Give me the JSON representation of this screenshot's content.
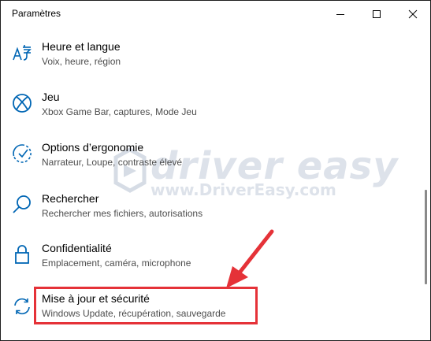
{
  "window": {
    "title": "Paramètres",
    "controls": {
      "minimize": "minimize-icon",
      "maximize": "maximize-icon",
      "close": "close-icon"
    }
  },
  "settings_items": [
    {
      "icon": "language-icon",
      "label": "Heure et langue",
      "description": "Voix, heure, région"
    },
    {
      "icon": "xbox-icon",
      "label": "Jeu",
      "description": "Xbox Game Bar, captures, Mode Jeu"
    },
    {
      "icon": "ease-of-access-icon",
      "label": "Options d’ergonomie",
      "description": "Narrateur, Loupe, contraste élevé"
    },
    {
      "icon": "search-icon",
      "label": "Rechercher",
      "description": "Rechercher mes fichiers, autorisations"
    },
    {
      "icon": "lock-icon",
      "label": "Confidentialité",
      "description": "Emplacement, caméra, microphone"
    },
    {
      "icon": "update-sync-icon",
      "label": "Mise à jour et sécurité",
      "description": "Windows Update, récupération, sauvegarde"
    }
  ],
  "watermark": {
    "logo_text": "driver easy",
    "url_text": "www.DriverEasy.com"
  },
  "annotation": {
    "highlight_color": "#e53238",
    "arrow_color": "#e53238"
  },
  "colors": {
    "accent": "#0066b4",
    "secondary_text": "#4d4d4d"
  }
}
